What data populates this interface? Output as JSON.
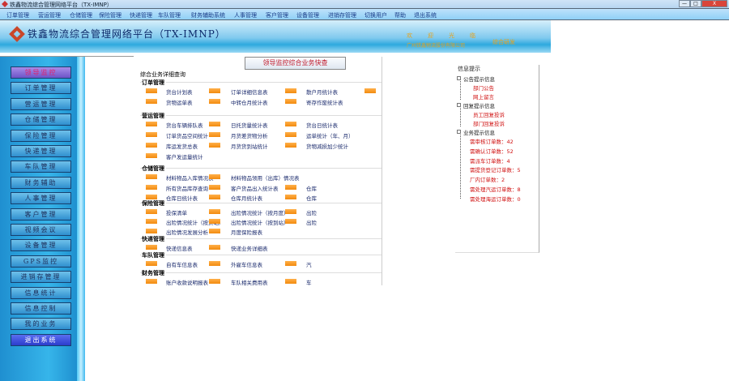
{
  "window": {
    "title": "铁鑫物流综合管理网络平台（TX-IMNP）",
    "minimize": "—",
    "maximize": "□",
    "close": "X"
  },
  "menu": [
    "订单管理",
    "营运管理",
    "仓储管理",
    "保险管理",
    "快递管理",
    "车队管理",
    "财务辅助系统",
    "人事管理",
    "客户管理",
    "设备管理",
    "进销存管理",
    "切换用户",
    "帮助",
    "退出系统"
  ],
  "banner": {
    "title": "铁鑫物流综合管理网络平台（TX-IMNP）",
    "welcome": "欢迎光临",
    "company": "广州铁鑫物流股份有限公司",
    "rd": "综合研发"
  },
  "sidebar": [
    "领导监控",
    "订单管理",
    "营运管理",
    "仓储管理",
    "保险管理",
    "快递管理",
    "车队管理",
    "财务辅助",
    "人事管理",
    "客户管理",
    "视频会议",
    "设备管理",
    "GPS监控",
    "进销存管理",
    "信息统计",
    "信息控制",
    "我的业务",
    "退出系统"
  ],
  "main": {
    "quick_button": "领导监控综合业务快查",
    "detail_title": "综合业务详细查询",
    "sections": [
      {
        "title": "订单管理",
        "rows": [
          [
            "货台计划表",
            "订单详细信息表",
            "散户月统计表",
            ""
          ],
          [
            "货物运单表",
            "中转仓月统计表",
            "寄存作废统计表"
          ]
        ]
      },
      {
        "title": "营运管理",
        "rows": [
          [
            "货台车辆排队表",
            "日托货量统计表",
            "货台日统计表"
          ],
          [
            "订单货品空间统计",
            "月货差货物分析",
            "运单统计（年、月）"
          ],
          [
            "库运发货总表",
            "月货货到站统计",
            "货物减损加少统计"
          ],
          [
            "客户发运量统计"
          ]
        ]
      },
      {
        "title": "仓储管理",
        "rows": [
          [
            "材料物品入库情况表",
            "材料物品领用（出库）情况表"
          ],
          [
            "所有货品库存查询",
            "客户货品出入统计表",
            "仓库"
          ],
          [
            "仓库日统计表",
            "仓库月统计表",
            "仓库"
          ]
        ]
      },
      {
        "title": "保险管理",
        "rows": [
          [
            "投保清单",
            "出险情况统计（按月度）",
            "出险"
          ],
          [
            "出险情况统计（按货站）",
            "出险情况统计（按到站）",
            "出险"
          ],
          [
            "出险情况发展分析",
            "月度保险报表"
          ]
        ]
      },
      {
        "title": "快递管理",
        "rows": [
          [
            "快递信息表",
            "快递业务详细表"
          ]
        ]
      },
      {
        "title": "车队管理",
        "rows": [
          [
            "自有车信息表",
            "外雇车信息表",
            "汽"
          ]
        ]
      },
      {
        "title": "财务管理",
        "rows": [
          [
            "账户收款说明报表",
            "车队相关费用表",
            "车"
          ]
        ]
      }
    ]
  },
  "info": {
    "title": "信息提示",
    "groups": [
      {
        "label": "公告提示信息",
        "items": [
          "部门公告",
          "网上留言"
        ]
      },
      {
        "label": "回复提示信息",
        "items": [
          "员工回复投诉",
          "部门回复投诉"
        ]
      },
      {
        "label": "业务提示信息",
        "items": [
          "需审核订单数：42",
          "需确认订单数：52",
          "需派车订单数：4",
          "需提货登记订单数：5",
          "厂内订单数：2",
          "需处理汽运订单数：8",
          "需处理海运订单数：0"
        ]
      }
    ]
  },
  "colors": {
    "accent": "#f28a0e",
    "link": "#1a2a6c",
    "alert": "#d01010",
    "sidebar": "#2f8fcf"
  }
}
